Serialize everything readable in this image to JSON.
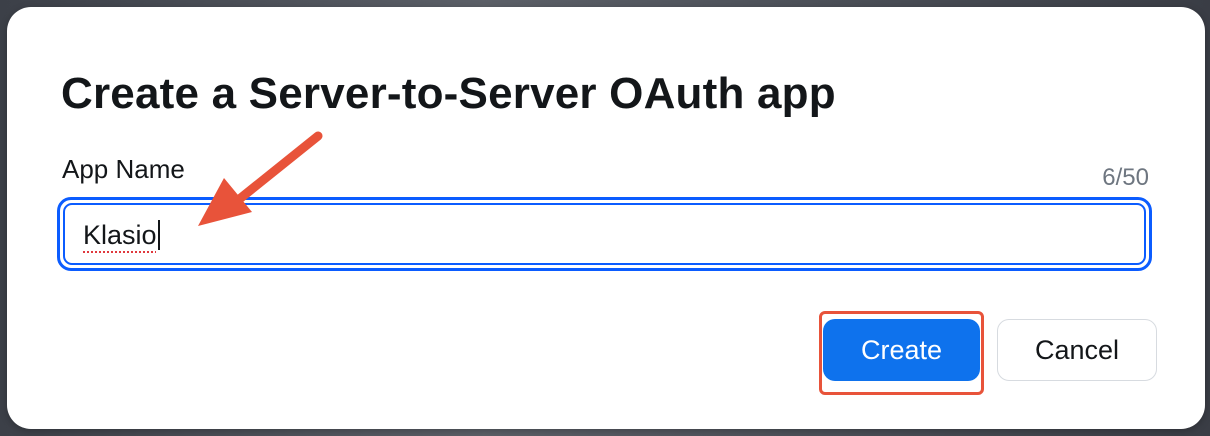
{
  "dialog": {
    "title": "Create a Server-to-Server OAuth app",
    "field_label": "App Name",
    "counter": "6/50",
    "input_value": "Klasio",
    "create_label": "Create",
    "cancel_label": "Cancel"
  },
  "colors": {
    "primary": "#0e72ed",
    "focus_ring": "#0b5cff",
    "annotation": "#e8533a",
    "text": "#131619"
  }
}
